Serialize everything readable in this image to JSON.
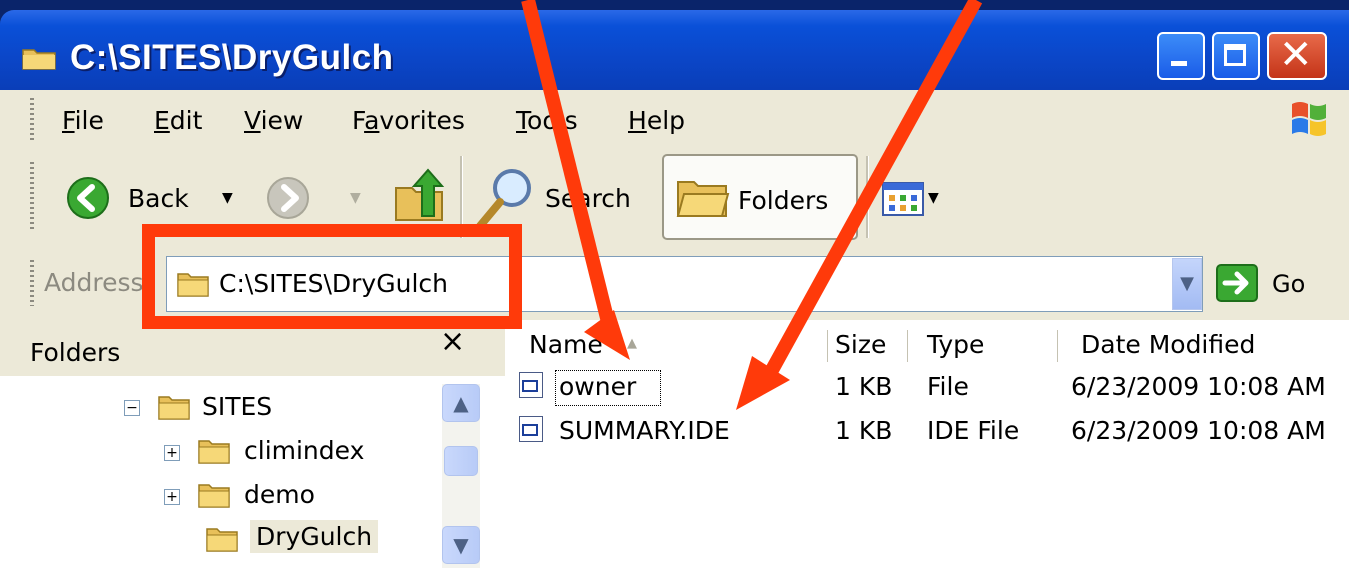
{
  "window": {
    "title": "C:\\SITES\\DryGulch",
    "close_glyph": "✕"
  },
  "menu": {
    "items": [
      {
        "pre": "",
        "key": "F",
        "post": "ile"
      },
      {
        "pre": "",
        "key": "E",
        "post": "dit"
      },
      {
        "pre": "",
        "key": "V",
        "post": "iew"
      },
      {
        "pre": "F",
        "key": "a",
        "post": "vorites"
      },
      {
        "pre": "",
        "key": "T",
        "post": "ools"
      },
      {
        "pre": "",
        "key": "H",
        "post": "elp"
      }
    ]
  },
  "toolbar": {
    "back_label": "Back",
    "search_label": "Search",
    "folders_label": "Folders"
  },
  "address": {
    "label": "Address",
    "value": "C:\\SITES\\DryGulch",
    "go_label": "Go"
  },
  "folders_pane": {
    "title": "Folders",
    "close_glyph": "×",
    "tree": [
      {
        "label": "SITES",
        "expander": "−"
      },
      {
        "label": "climindex",
        "expander": "+"
      },
      {
        "label": "demo",
        "expander": "+"
      },
      {
        "label": "DryGulch",
        "expander": ""
      }
    ]
  },
  "file_list": {
    "columns": [
      "Name",
      "Size",
      "Type",
      "Date Modified"
    ],
    "rows": [
      {
        "name": "owner",
        "size": "1 KB",
        "type": "File",
        "date": "6/23/2009 10:08 AM"
      },
      {
        "name": "SUMMARY.IDE",
        "size": "1 KB",
        "type": "IDE File",
        "date": "6/23/2009 10:08 AM"
      }
    ]
  },
  "colors": {
    "annotation": "#ff3a0a",
    "titlebar": "#0a50d8",
    "chrome": "#ece9d8"
  }
}
